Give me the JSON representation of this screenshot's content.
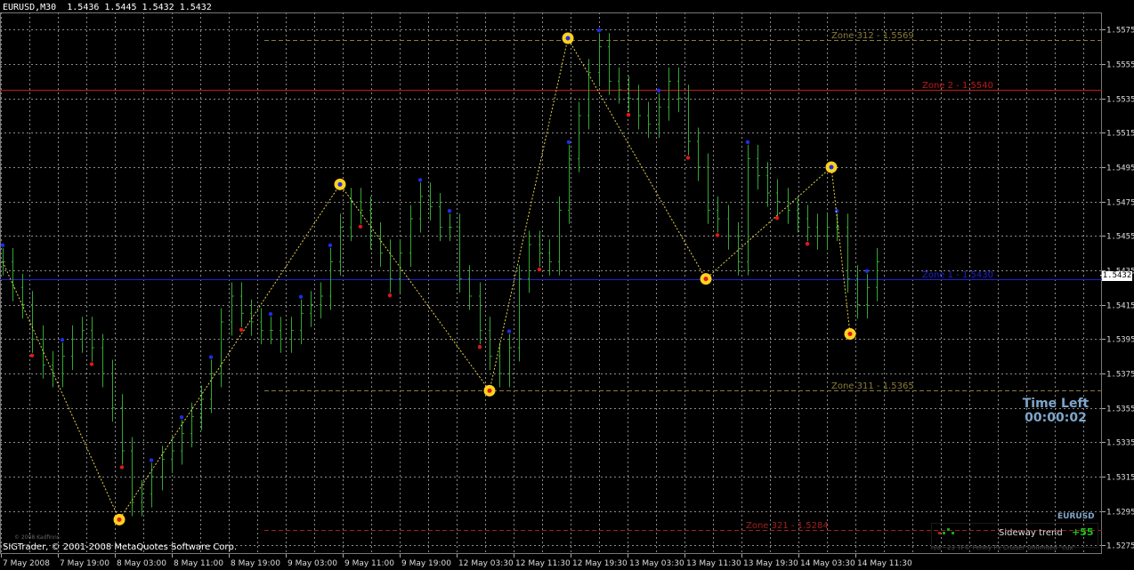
{
  "header": {
    "symbol_period": "EURUSD,M30",
    "ohlc": "1.5436 1.5445 1.5432 1.5432"
  },
  "footer": {
    "copyright": "SIGTrader, © 2001-2008 MetaQuotes Software Corp.",
    "small_logo": "© 2008 Kadfinns"
  },
  "current_price": "1.5432",
  "zones": [
    {
      "label": "Zone 312 - 1.5569",
      "price": 1.5569,
      "color": "#8a7a3a",
      "style": "dashed"
    },
    {
      "label": "Zone 2 - 1.5540",
      "price": 1.554,
      "color": "#c01818",
      "style": "solid"
    },
    {
      "label": "Zone 1 - 1.5430",
      "price": 1.543,
      "color": "#2020d0",
      "style": "solid"
    },
    {
      "label": "Zone 311 - 1.5365",
      "price": 1.5365,
      "color": "#8a7a3a",
      "style": "dashed"
    },
    {
      "label": "Zone 321 - 1.5284",
      "price": 1.5284,
      "color": "#a02020",
      "style": "dashed"
    }
  ],
  "time_left": {
    "title": "Time Left",
    "value": "00:00:02"
  },
  "trend_panel": {
    "symbol": "EURUSD",
    "trend_text": "Sideway trend",
    "score": "+55",
    "subtitle": "n/a - 23 TF© Penny Px Cruiser Unlimited \"cux\""
  },
  "colors": {
    "background": "#000000",
    "grid": "#8a8a8a",
    "bars": "#33a533",
    "zigzag": "#e6d24a",
    "up_dot": "#1e2ee6",
    "down_dot": "#e01818",
    "pivot": "#ffd21e"
  },
  "chart_data": {
    "type": "line",
    "symbol": "EURUSD",
    "timeframe": "M30",
    "ylim": [
      1.527,
      1.5585
    ],
    "yticks": [
      "1.5575",
      "1.5555",
      "1.5535",
      "1.5515",
      "1.5495",
      "1.5475",
      "1.5455",
      "1.5435",
      "1.5415",
      "1.5395",
      "1.5375",
      "1.5355",
      "1.5335",
      "1.5315",
      "1.5295",
      "1.5275"
    ],
    "xticks": [
      "7 May 2008",
      "7 May 19:00",
      "8 May 03:00",
      "8 May 11:00",
      "8 May 19:00",
      "9 May 03:00",
      "9 May 11:00",
      "9 May 19:00",
      "12 May 03:30",
      "12 May 11:30",
      "12 May 19:30",
      "13 May 03:30",
      "13 May 11:30",
      "13 May 19:30",
      "14 May 03:30",
      "14 May 11:30"
    ],
    "grid": true,
    "series": [
      {
        "name": "EURUSD",
        "values": [
          1.544,
          1.5425,
          1.5415,
          1.5395,
          1.538,
          1.5375,
          1.5385,
          1.5395,
          1.54,
          1.539,
          1.5375,
          1.5355,
          1.533,
          1.53,
          1.5305,
          1.5315,
          1.5325,
          1.533,
          1.534,
          1.535,
          1.536,
          1.5375,
          1.5405,
          1.542,
          1.541,
          1.5405,
          1.54,
          1.54,
          1.5395,
          1.54,
          1.541,
          1.5415,
          1.542,
          1.544,
          1.546,
          1.5475,
          1.547,
          1.5455,
          1.5445,
          1.543,
          1.5445,
          1.5465,
          1.5478,
          1.5472,
          1.546,
          1.546,
          1.543,
          1.542,
          1.54,
          1.5385,
          1.5375,
          1.539,
          1.543,
          1.545,
          1.5445,
          1.544,
          1.547,
          1.55,
          1.5525,
          1.555,
          1.5565,
          1.5545,
          1.554,
          1.5535,
          1.5525,
          1.552,
          1.553,
          1.5545,
          1.5535,
          1.551,
          1.5495,
          1.547,
          1.5465,
          1.5455,
          1.544,
          1.55,
          1.549,
          1.548,
          1.5475,
          1.547,
          1.5465,
          1.546,
          1.5455,
          1.546,
          1.546,
          1.543,
          1.5415,
          1.5425,
          1.544
        ]
      },
      {
        "name": "ZigZag",
        "values": [
          1.544,
          1.529,
          1.5485,
          1.5365,
          1.557,
          1.543,
          1.5495,
          1.5398
        ]
      }
    ],
    "pivots_highlighted": [
      1.529,
      1.5485,
      1.5365,
      1.557,
      1.543,
      1.5495,
      1.5398
    ]
  }
}
